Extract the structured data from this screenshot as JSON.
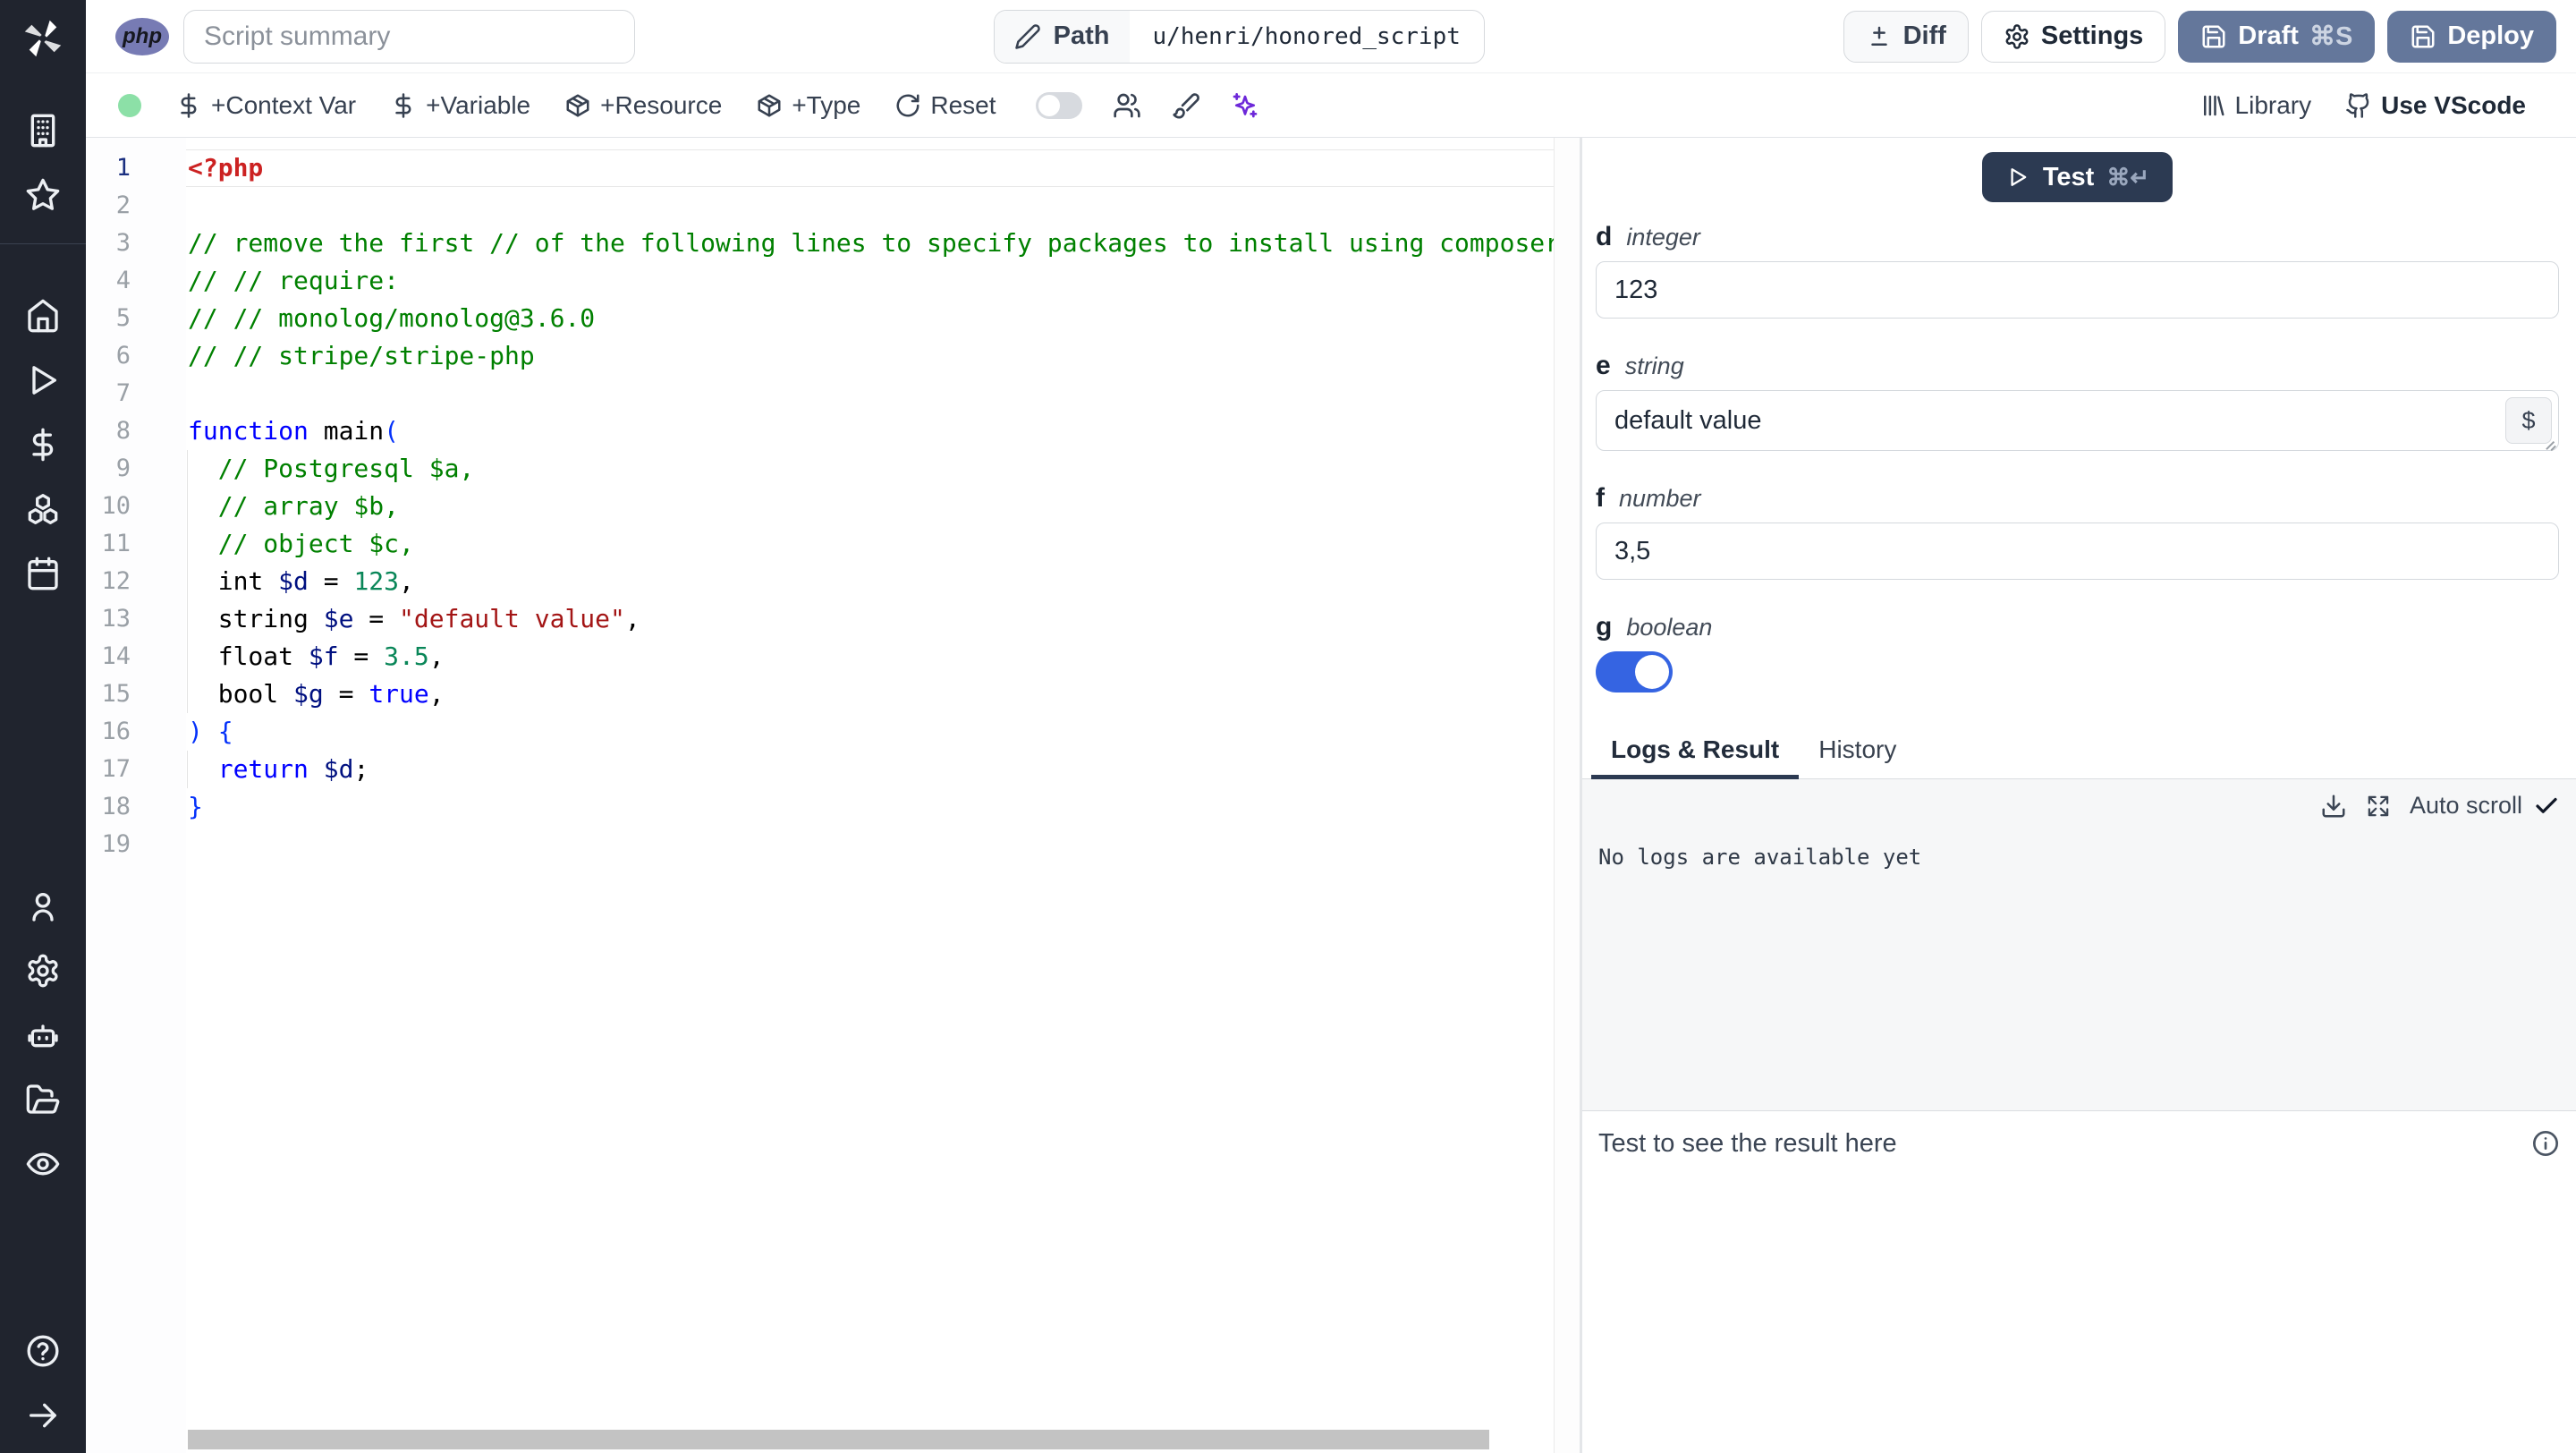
{
  "topbar": {
    "language_badge": "php",
    "summary_placeholder": "Script summary",
    "path_label": "Path",
    "path_value": "u/henri/honored_script",
    "diff_label": "Diff",
    "settings_label": "Settings",
    "draft_label": "Draft",
    "draft_shortcut": "⌘S",
    "deploy_label": "Deploy"
  },
  "toolbar": {
    "add_context_var": "+Context Var",
    "add_variable": "+Variable",
    "add_resource": "+Resource",
    "add_type": "+Type",
    "reset": "Reset",
    "library": "Library",
    "use_vscode": "Use VScode"
  },
  "editor": {
    "language": "php",
    "active_line": 1,
    "indent_guide_lines": [
      9,
      10,
      11,
      12,
      13,
      14,
      15,
      17
    ],
    "lines": [
      [
        [
          "metatag",
          "<?php"
        ]
      ],
      [],
      [
        [
          "comment",
          "// remove the first // of the following lines to specify packages to install using composer"
        ]
      ],
      [
        [
          "comment",
          "// // require:"
        ]
      ],
      [
        [
          "comment",
          "// // monolog/monolog@3.6.0"
        ]
      ],
      [
        [
          "comment",
          "// // stripe/stripe-php"
        ]
      ],
      [],
      [
        [
          "keyword",
          "function"
        ],
        [
          "plain",
          " main"
        ],
        [
          "bracket",
          "("
        ]
      ],
      [
        [
          "comment",
          "  // Postgresql $a,"
        ]
      ],
      [
        [
          "comment",
          "  // array $b,"
        ]
      ],
      [
        [
          "comment",
          "  // object $c,"
        ]
      ],
      [
        [
          "plain",
          "  int "
        ],
        [
          "variable",
          "$d"
        ],
        [
          "plain",
          " = "
        ],
        [
          "number",
          "123"
        ],
        [
          "plain",
          ","
        ]
      ],
      [
        [
          "plain",
          "  string "
        ],
        [
          "variable",
          "$e"
        ],
        [
          "plain",
          " = "
        ],
        [
          "string",
          "\"default value\""
        ],
        [
          "plain",
          ","
        ]
      ],
      [
        [
          "plain",
          "  float "
        ],
        [
          "variable",
          "$f"
        ],
        [
          "plain",
          " = "
        ],
        [
          "number",
          "3.5"
        ],
        [
          "plain",
          ","
        ]
      ],
      [
        [
          "plain",
          "  bool "
        ],
        [
          "variable",
          "$g"
        ],
        [
          "plain",
          " = "
        ],
        [
          "keyword",
          "true"
        ],
        [
          "plain",
          ","
        ]
      ],
      [
        [
          "bracket",
          ") {"
        ]
      ],
      [
        [
          "plain",
          "  "
        ],
        [
          "keyword",
          "return"
        ],
        [
          "plain",
          " "
        ],
        [
          "variable",
          "$d"
        ],
        [
          "plain",
          ";"
        ]
      ],
      [
        [
          "bracket",
          "}"
        ]
      ],
      []
    ]
  },
  "right_panel": {
    "test_button": "Test",
    "test_shortcut": "⌘↵",
    "dollar_button": "$",
    "fields": [
      {
        "name": "d",
        "type": "integer",
        "value": "123"
      },
      {
        "name": "e",
        "type": "string",
        "value": "default value"
      },
      {
        "name": "f",
        "type": "number",
        "value": "3,5"
      },
      {
        "name": "g",
        "type": "boolean",
        "value": true
      }
    ],
    "tabs": {
      "logs": "Logs & Result",
      "history": "History"
    },
    "active_tab": "Logs & Result",
    "auto_scroll_label": "Auto scroll",
    "no_logs_message": "No logs are available yet",
    "result_placeholder": "Test to see the result here"
  },
  "colors": {
    "sidebar_bg": "#20242e",
    "primary_button": "#64779b",
    "test_button": "#2c3a52",
    "toggle_on": "#3564e2",
    "status_dot": "#8ce0a7",
    "ai_icon": "#6d28d9",
    "php_badge": "#777bb4"
  }
}
